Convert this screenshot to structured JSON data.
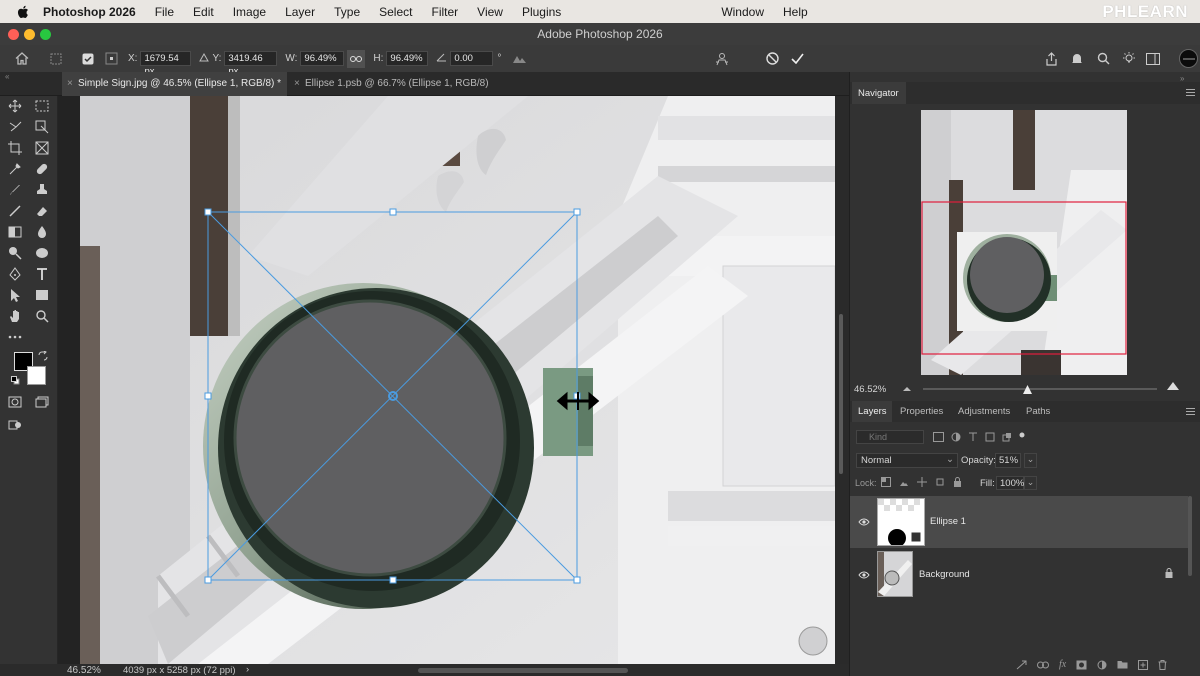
{
  "menubar": {
    "app_name": "Photoshop 2026",
    "items": [
      "File",
      "Edit",
      "Image",
      "Layer",
      "Type",
      "Select",
      "Filter",
      "View",
      "Plugins"
    ],
    "right_items": [
      "Window",
      "Help"
    ],
    "brand": "PHLEARN"
  },
  "window": {
    "title": "Adobe Photoshop 2026"
  },
  "options": {
    "x_label": "X:",
    "x_value": "1679.54 px",
    "y_label": "Y:",
    "y_value": "3419.46 px",
    "w_label": "W:",
    "w_value": "96.49%",
    "h_label": "H:",
    "h_value": "96.49%",
    "angle_value": "0.00",
    "angle_unit": "°"
  },
  "tabs": [
    {
      "label": "Simple Sign.jpg @ 46.5% (Ellipse 1, RGB/8) *",
      "active": true
    },
    {
      "label": "Ellipse 1.psb @ 66.7% (Ellipse 1, RGB/8)",
      "active": false
    }
  ],
  "status": {
    "zoom": "46.52%",
    "doc_info": "4039 px x 5258 px (72 ppi)",
    "arrow": "›"
  },
  "navigator": {
    "title": "Navigator",
    "zoom": "46.52%"
  },
  "layers_panel": {
    "tabs": [
      "Layers",
      "Properties",
      "Adjustments",
      "Paths"
    ],
    "filter_placeholder": "Kind",
    "blend_mode": "Normal",
    "opacity_label": "Opacity:",
    "opacity_value": "51%",
    "lock_label": "Lock:",
    "fill_label": "Fill:",
    "fill_value": "100%",
    "layers": [
      {
        "name": "Ellipse 1",
        "selected": true,
        "visible": true,
        "locked": false
      },
      {
        "name": "Background",
        "selected": false,
        "visible": true,
        "locked": true
      }
    ]
  },
  "colors": {
    "accent": "#3a8fd9",
    "selection_handle": "#4a9be0",
    "sign_face": "#5f5f5f",
    "sign_rim": "#2f3d34"
  },
  "icons": [
    "apple-icon",
    "home-icon",
    "move-tool-icon",
    "commit-icon",
    "cancel-icon",
    "share-icon",
    "bell-icon",
    "search-icon",
    "lightbulb-icon",
    "workspace-icon",
    "eye-icon",
    "lock-icon",
    "link-icon",
    "fx-icon",
    "mask-icon",
    "adjustment-icon",
    "folder-icon",
    "new-layer-icon",
    "trash-icon"
  ]
}
